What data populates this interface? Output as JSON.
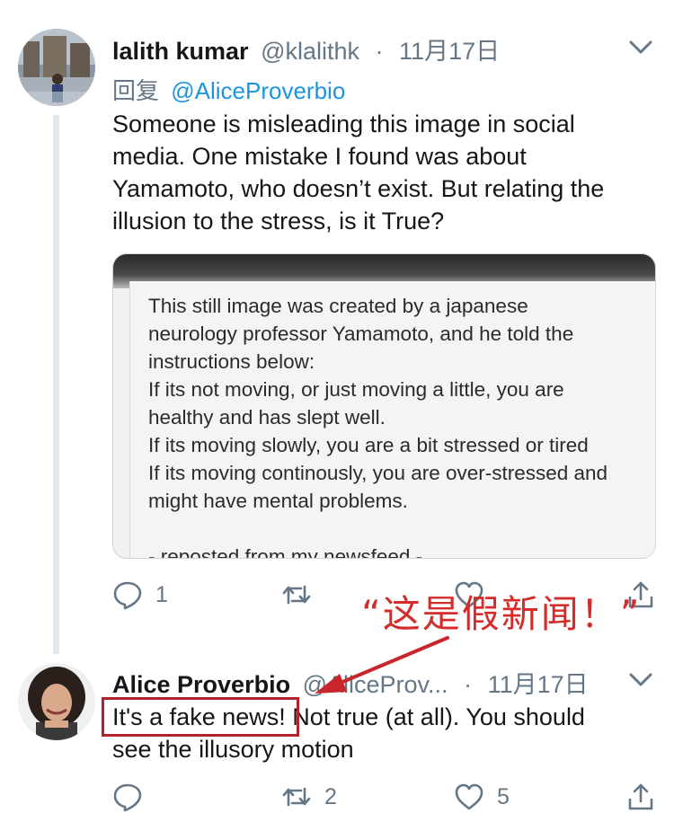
{
  "tweet1": {
    "name": "lalith kumar",
    "handle": "@klalithk",
    "dot": "·",
    "date": "11月17日",
    "reply_prefix": "回复",
    "reply_mention": "@AliceProverbio",
    "text_lines": [
      "Someone is misleading this image in social",
      "media. One mistake I found was about",
      "Yamamoto, who doesn’t exist. But relating the",
      "illusion to the stress, is it True?"
    ],
    "card_lines": [
      "This still image was created by a japanese",
      "neurology professor Yamamoto, and he told the",
      "instructions below:",
      "If its not moving, or just moving a little, you are",
      "healthy and has slept well.",
      "If its moving slowly, you are a bit stressed or tired",
      "If its moving continously, you are over-stressed and",
      "might have mental problems.",
      "",
      "- reposted from my newsfeed -"
    ],
    "reply_count": "1"
  },
  "annotation": "“这是假新闻！”",
  "tweet2": {
    "name": "Alice Proverbio",
    "handle": "@AliceProv...",
    "dot": "·",
    "date": "11月17日",
    "text_highlight": "It's a fake news!",
    "text_rest": " Not true (at all). You should",
    "text_line2": "see the illusory motion",
    "retweet_count": "2",
    "like_count": "5"
  },
  "colors": {
    "link": "#1b95e0",
    "muted": "#657786",
    "annotation_red": "#d42b2b"
  },
  "icons": [
    "chevron-down-icon",
    "reply-icon",
    "retweet-icon",
    "like-icon",
    "share-icon"
  ]
}
